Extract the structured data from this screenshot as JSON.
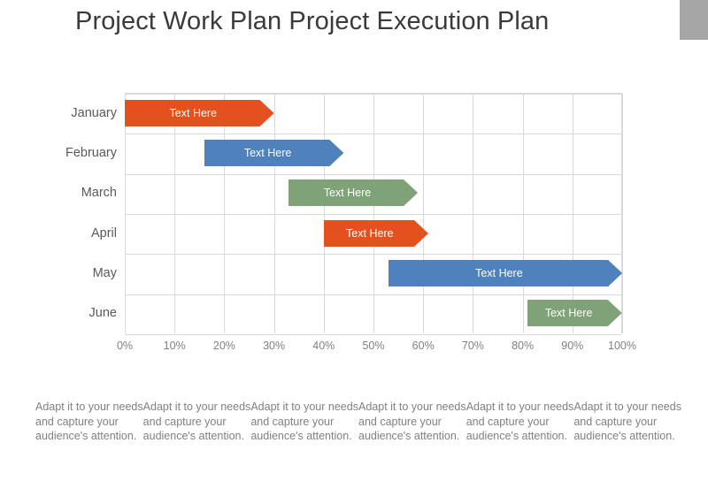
{
  "title": "Project Work Plan Project Execution Plan",
  "corner_block_color": "#a6a6a6",
  "chart_data": {
    "type": "bar",
    "subtype": "gantt",
    "title": "Project Work Plan Project Execution Plan",
    "xlabel": "",
    "ylabel": "",
    "xlim": [
      0,
      100
    ],
    "grid": true,
    "legend": "none",
    "categories": [
      "January",
      "February",
      "March",
      "April",
      "May",
      "June"
    ],
    "xtick_labels": [
      "0%",
      "10%",
      "20%",
      "30%",
      "40%",
      "50%",
      "60%",
      "70%",
      "80%",
      "90%",
      "100%"
    ],
    "xtick_values": [
      0,
      10,
      20,
      30,
      40,
      50,
      60,
      70,
      80,
      90,
      100
    ],
    "bars": [
      {
        "category": "January",
        "label": "Text Here",
        "start": 0,
        "end": 30,
        "color": "#e2511e"
      },
      {
        "category": "February",
        "label": "Text Here",
        "start": 16,
        "end": 44,
        "color": "#4f81bd"
      },
      {
        "category": "March",
        "label": "Text Here",
        "start": 33,
        "end": 59,
        "color": "#7fa279"
      },
      {
        "category": "April",
        "label": "Text Here",
        "start": 40,
        "end": 61,
        "color": "#e2511e"
      },
      {
        "category": "May",
        "label": "Text Here",
        "start": 53,
        "end": 100,
        "color": "#4f81bd"
      },
      {
        "category": "June",
        "label": "Text Here",
        "start": 81,
        "end": 100,
        "color": "#7fa279"
      }
    ]
  },
  "captions": [
    "Adapt it to your needs and capture your audience's attention.",
    "Adapt it to your needs and capture your audience's attention.",
    "Adapt it to your needs and capture your audience's attention.",
    "Adapt it to your needs and capture your audience's attention.",
    "Adapt it to your needs and capture your audience's attention.",
    "Adapt it to your needs and capture your audience's attention."
  ]
}
